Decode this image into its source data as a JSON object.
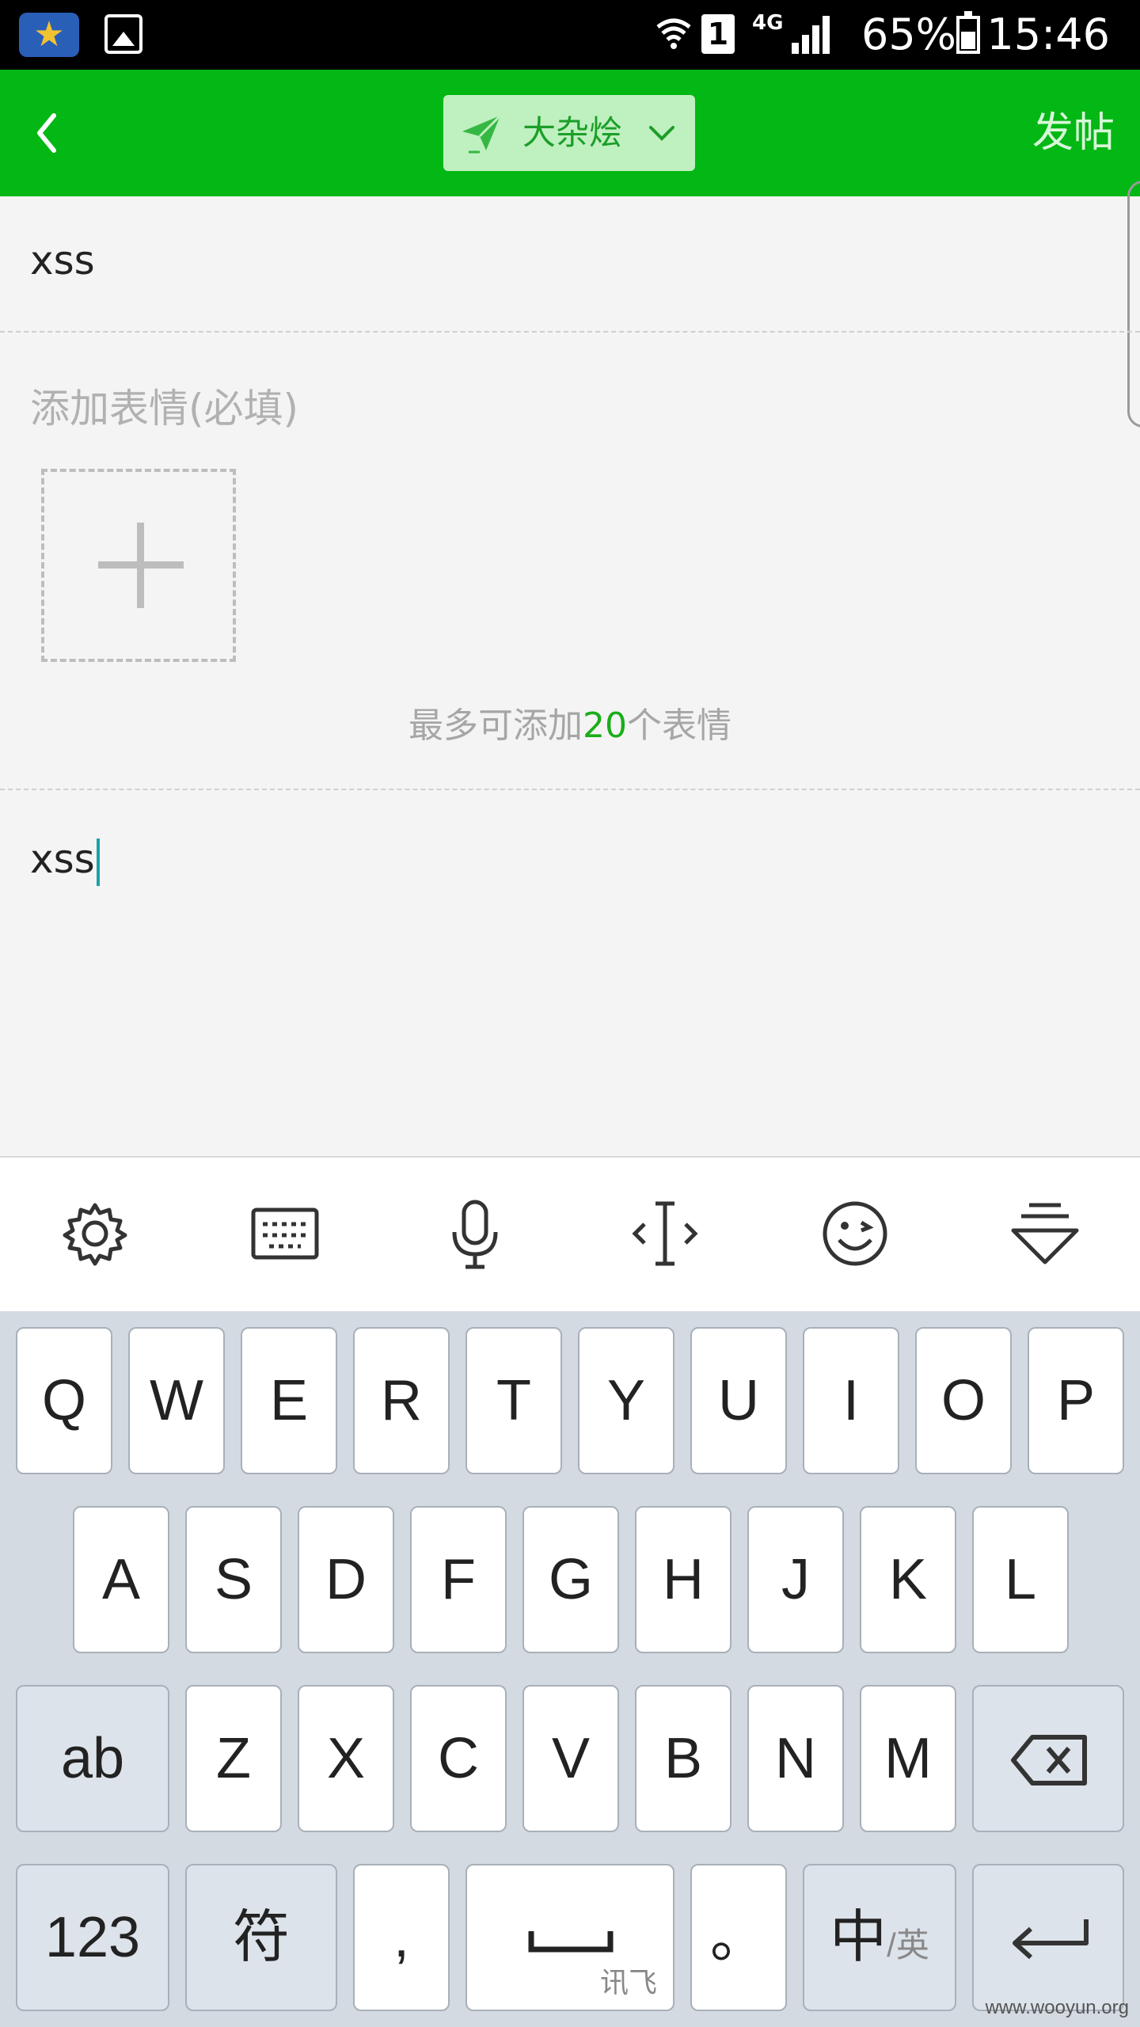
{
  "status_bar": {
    "network": "4G",
    "sim": "1",
    "battery": "65%",
    "time": "15:46"
  },
  "header": {
    "back_icon": "back-arrow-icon",
    "category": "大杂烩",
    "post_label": "发帖",
    "accent": "#03b714"
  },
  "form": {
    "title_value": "xss",
    "emoji_hint": "添加表情(必填)",
    "limit_prefix": "最多可添加",
    "limit_count": "20",
    "limit_suffix": "个表情",
    "content_value": "xss"
  },
  "keyboard": {
    "toolbar_icons": [
      "gear-icon",
      "keyboard-icon",
      "microphone-icon",
      "cursor-icon",
      "emoji-icon",
      "collapse-keyboard-icon"
    ],
    "row1": [
      "Q",
      "W",
      "E",
      "R",
      "T",
      "Y",
      "U",
      "I",
      "O",
      "P"
    ],
    "row2": [
      "A",
      "S",
      "D",
      "F",
      "G",
      "H",
      "J",
      "K",
      "L"
    ],
    "row3": [
      "Z",
      "X",
      "C",
      "V",
      "B",
      "N",
      "M"
    ],
    "shift_label": "ab",
    "num_label": "123",
    "symbol_label": "符",
    "comma_label": ",",
    "space_brand": "讯飞",
    "period_label": "。",
    "lang_main": "中",
    "lang_sub": "/英"
  },
  "watermark": "www.wooyun.org"
}
